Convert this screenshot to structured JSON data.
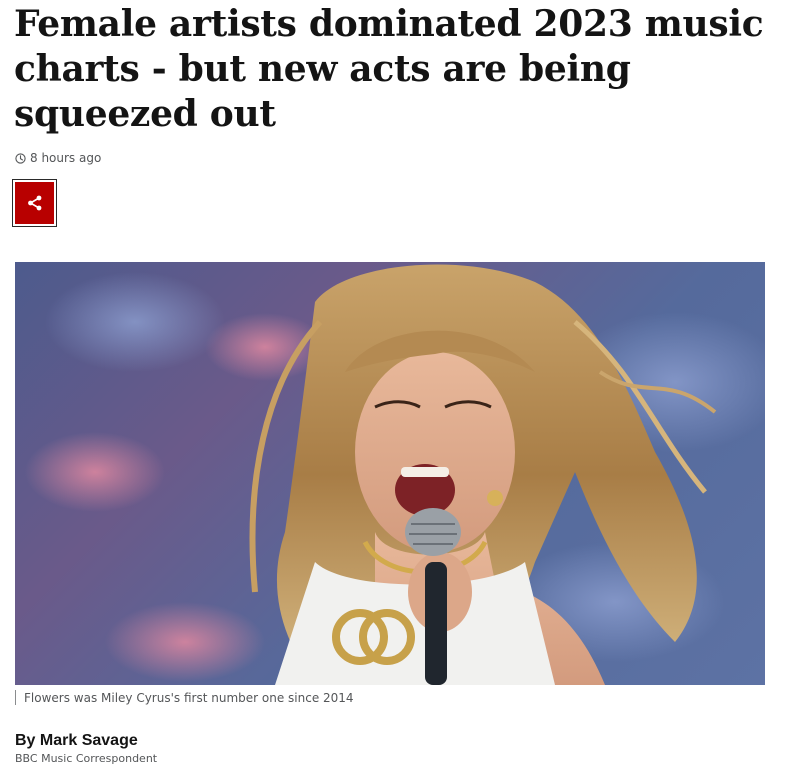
{
  "article": {
    "headline": "Female artists dominated 2023 music charts - but new acts are being squeezed out",
    "timestamp": "8 hours ago",
    "timestamp_icon": "clock-icon",
    "share_icon": "share-icon",
    "image": {
      "description_icon": "photo",
      "caption": "Flowers was Miley Cyrus's first number one since 2014"
    },
    "byline": {
      "author": "By Mark Savage",
      "role": "BBC Music Correspondent"
    }
  },
  "colors": {
    "share_button": "#b80000",
    "headline": "#141414",
    "meta_text": "#545658"
  }
}
